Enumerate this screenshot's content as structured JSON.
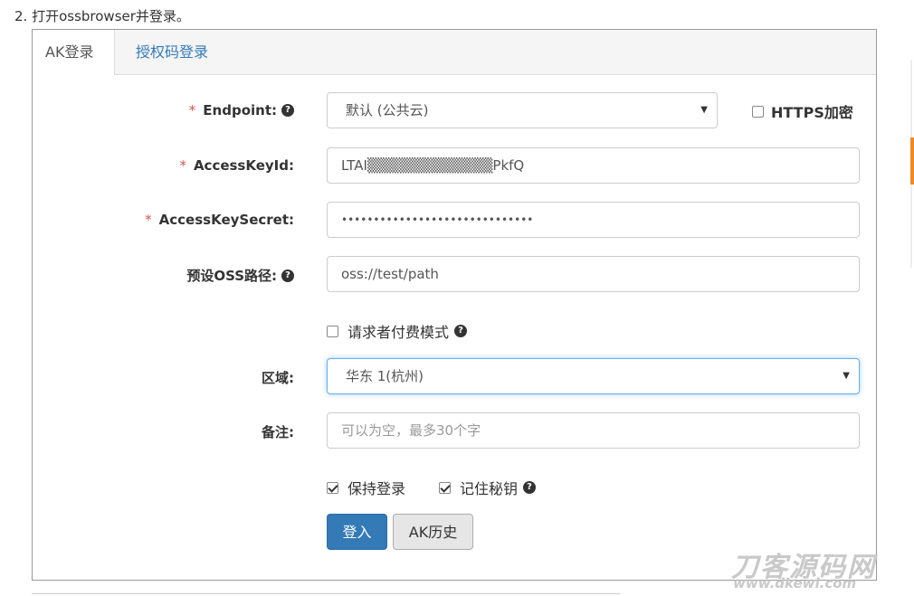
{
  "step_text": "2. 打开ossbrowser并登录。",
  "tabs": [
    {
      "label": "AK登录",
      "active": true
    },
    {
      "label": "授权码登录",
      "active": false
    }
  ],
  "form": {
    "endpoint": {
      "label": "Endpoint:",
      "value": "默认 (公共云)",
      "https_label": "HTTPS加密",
      "https_checked": false
    },
    "access_key_id": {
      "label": "AccessKeyId:",
      "value": "LTAI▒▒▒▒▒▒▒▒▒▒▒▒PkfQ"
    },
    "access_key_secret": {
      "label": "AccessKeySecret:",
      "value": "••••••••••••••••••••••••••••••"
    },
    "oss_path": {
      "label": "预设OSS路径:",
      "value": "oss://test/path"
    },
    "requester_pays": {
      "label": "请求者付费模式",
      "checked": false
    },
    "region": {
      "label": "区域:",
      "value": "华东 1(杭州)"
    },
    "note": {
      "label": "备注:",
      "placeholder": "可以为空，最多30个字"
    },
    "keep_login": {
      "label": "保持登录",
      "checked": true
    },
    "remember_secret": {
      "label": "记住秘钥",
      "checked": true
    }
  },
  "buttons": {
    "login": "登入",
    "ak_history": "AK历史"
  },
  "required_mark": "*",
  "help_glyph": "?",
  "caret_glyph": "▼",
  "watermark": {
    "line1": "刀客源码网",
    "line2": "www.dkewl.com"
  },
  "colors": {
    "primary": "#337ab7",
    "required": "#d9534f",
    "accent_scroll": "#f08a24"
  }
}
